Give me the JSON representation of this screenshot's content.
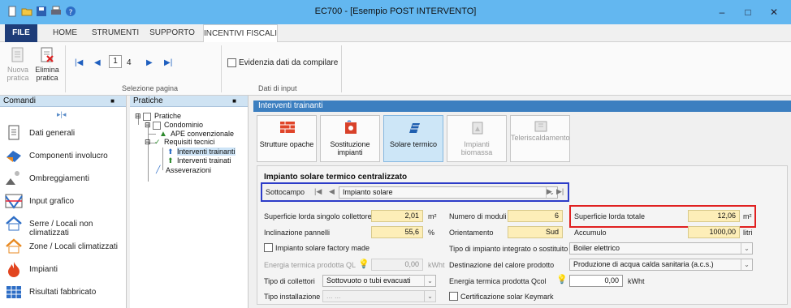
{
  "window": {
    "title": "EC700 - [Esempio POST INTERVENTO]",
    "minimize": "–",
    "maximize": "□",
    "close": "✕"
  },
  "ribbon_tabs": [
    "FILE",
    "HOME",
    "STRUMENTI",
    "SUPPORTO",
    "INCENTIVI FISCALI"
  ],
  "ribbon": {
    "nuova_pratica": "Nuova pratica",
    "elimina_pratica": "Elimina pratica",
    "page_current": "1",
    "page_total": "4",
    "group_selezione": "Selezione pagina",
    "evidenzia": "Evidenzia dati da compilare",
    "group_dati_input": "Dati di input"
  },
  "comandi": {
    "title": "Comandi",
    "pin": "■",
    "items": [
      "Dati generali",
      "Componenti involucro",
      "Ombreggiamenti",
      "Input grafico",
      "Serre / Locali non climatizzati",
      "Zone / Locali climatizzati",
      "Impianti",
      "Risultati fabbricato"
    ]
  },
  "pratiche": {
    "title": "Pratiche",
    "pin": "■",
    "tree": [
      "Pratiche",
      "Condominio",
      "APE convenzionale",
      "Requisiti tecnici",
      "Interventi trainanti",
      "Interventi trainati",
      "Asseverazioni"
    ]
  },
  "main": {
    "header": "Interventi trainanti",
    "buttons": [
      {
        "label": "Strutture opache"
      },
      {
        "label": "Sostituzione impianti"
      },
      {
        "label": "Solare termico"
      },
      {
        "label": "Impianti biomassa"
      },
      {
        "label": "Teleriscaldamento"
      }
    ],
    "section_title": "Impianto solare termico centralizzato",
    "sottocampo_label": "Sottocampo",
    "sottocampo_value": "Impianto solare",
    "fields": {
      "superficie_singolo_label": "Superficie lorda singolo collettore",
      "superficie_singolo_value": "2,01",
      "superficie_singolo_unit": "m²",
      "inclinazione_label": "Inclinazione pannelli",
      "inclinazione_value": "55,6",
      "inclinazione_unit": "%",
      "factory_label": "Impianto solare factory made",
      "energia_ql_label": "Energia termica prodotta QL",
      "energia_ql_value": "0,00",
      "energia_ql_unit": "kWht",
      "tipo_collettori_label": "Tipo di collettori",
      "tipo_collettori_value": "Sottovuoto o tubi evacuati",
      "tipo_installazione_label": "Tipo installazione",
      "tipo_installazione_value": "... ...",
      "numero_moduli_label": "Numero di moduli",
      "numero_moduli_value": "6",
      "orientamento_label": "Orientamento",
      "orientamento_value": "Sud",
      "tipo_impianto_label": "Tipo di impianto integrato o sostituito",
      "tipo_impianto_value": "Boiler elettrico",
      "destinazione_label": "Destinazione del calore prodotto",
      "destinazione_value": "Produzione di acqua calda sanitaria (a.c.s.)",
      "energia_qcol_label": "Energia termica prodotta  Qcol",
      "energia_qcol_value": "0,00",
      "energia_qcol_unit": "kWht",
      "certificazione_label": "Certificazione solar Keymark",
      "superficie_totale_label": "Superficie lorda totale",
      "superficie_totale_value": "12,06",
      "superficie_totale_unit": "m²",
      "accumulo_label": "Accumulo",
      "accumulo_value": "1000,00",
      "accumulo_unit": "litri"
    }
  }
}
